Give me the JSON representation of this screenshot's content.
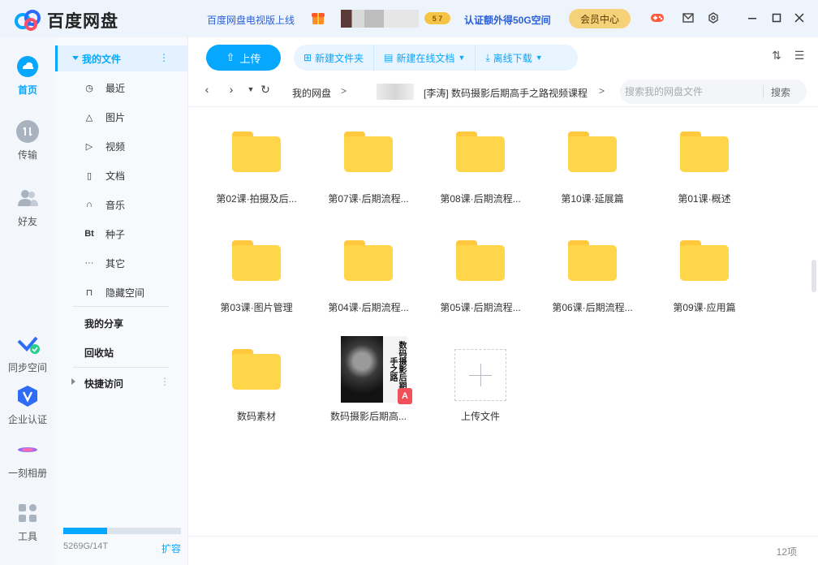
{
  "titlebar": {
    "app_name": "百度网盘",
    "tv_link": "百度网盘电视版上线",
    "badge": "5 7",
    "verify_link": "认证额外得50G空间",
    "vip_button": "会员中心"
  },
  "rail": {
    "items": [
      {
        "label": "首页",
        "icon": "cloud-icon"
      },
      {
        "label": "传输",
        "icon": "transfer-icon"
      },
      {
        "label": "好友",
        "icon": "friends-icon"
      },
      {
        "label": "同步空间",
        "icon": "sync-icon"
      },
      {
        "label": "企业认证",
        "icon": "enterprise-icon"
      },
      {
        "label": "一刻相册",
        "icon": "album-icon"
      },
      {
        "label": "工具",
        "icon": "tools-icon"
      }
    ]
  },
  "sidebar": {
    "my_files": "我的文件",
    "items": [
      {
        "label": "最近",
        "icon": "clock-icon"
      },
      {
        "label": "图片",
        "icon": "image-icon"
      },
      {
        "label": "视频",
        "icon": "play-icon"
      },
      {
        "label": "文档",
        "icon": "doc-icon"
      },
      {
        "label": "音乐",
        "icon": "headphones-icon"
      },
      {
        "label": "种子",
        "icon": "bt-icon"
      },
      {
        "label": "其它",
        "icon": "more-icon"
      },
      {
        "label": "隐藏空间",
        "icon": "lock-icon"
      }
    ],
    "my_share": "我的分享",
    "recycle": "回收站",
    "quick_access": "快捷访问",
    "storage_text": "5269G/14T",
    "storage_used": 0.37,
    "expand": "扩容"
  },
  "toolbar": {
    "upload": "上传",
    "new_folder": "新建文件夹",
    "new_doc": "新建在线文档",
    "offline_download": "离线下载"
  },
  "address": {
    "root": "我的网盘",
    "current": "[李涛] 数码摄影后期高手之路视频课程",
    "search_placeholder": "搜索我的网盘文件",
    "search_button": "搜索"
  },
  "files": [
    "第02课·拍摄及后...",
    "第07课·后期流程...",
    "第08课·后期流程...",
    "第10课·延展篇",
    "第01课·概述",
    "第03课·图片管理",
    "第04课·后期流程...",
    "第05课·后期流程...",
    "第06课·后期流程...",
    "第09课·应用篇",
    "数码素材",
    "数码摄影后期高..."
  ],
  "pdf_cover_text": "数码摄影后期高手之路",
  "pdf_badge": "A",
  "upload_tile": "上传文件",
  "status": {
    "count": "12项"
  },
  "colors": {
    "accent": "#06a7ff",
    "folder": "#ffd54a"
  }
}
